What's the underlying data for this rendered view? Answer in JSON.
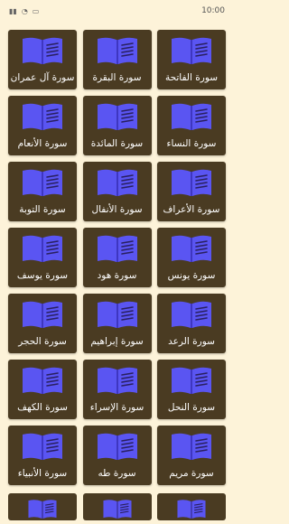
{
  "status_bar": {
    "time": "10:00",
    "icons": [
      "signal-icon",
      "wifi-icon",
      "battery-icon"
    ]
  },
  "colors": {
    "background": "#fdf3d9",
    "card": "#4a3b22",
    "book_blue": "#5a55f2",
    "book_lines": "#2a2060"
  },
  "surahs": [
    "سورة الفاتحة",
    "سورة البقرة",
    "سورة آل عمران",
    "سورة النساء",
    "سورة المائدة",
    "سورة الأنعام",
    "سورة الأعراف",
    "سورة الأنفال",
    "سورة التوبة",
    "سورة يونس",
    "سورة هود",
    "سورة يوسف",
    "سورة الرعد",
    "سورة إبراهيم",
    "سورة الحجر",
    "سورة النحل",
    "سورة الإسراء",
    "سورة الكهف",
    "سورة مريم",
    "سورة طه",
    "سورة الأنبياء"
  ]
}
